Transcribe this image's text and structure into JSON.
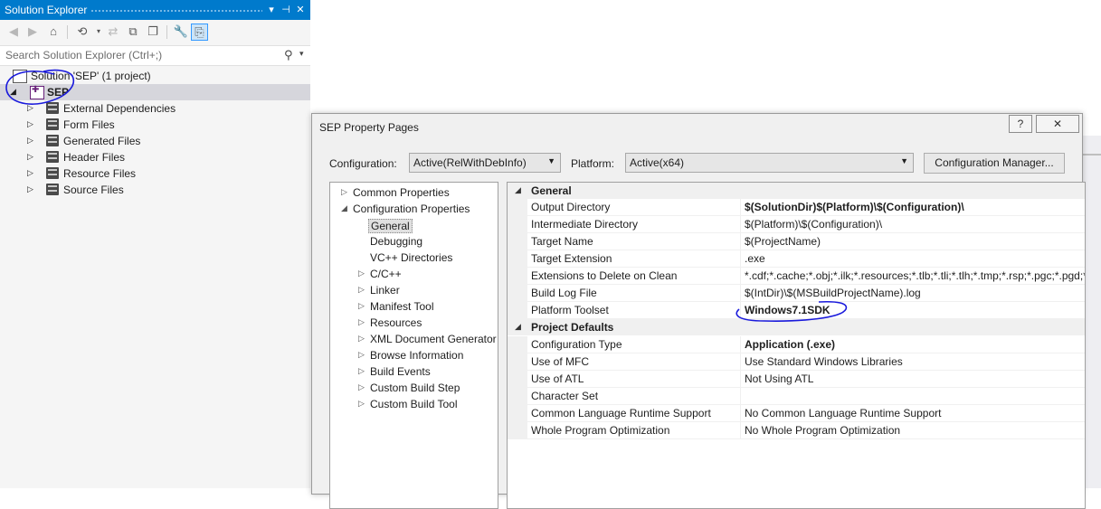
{
  "solution_explorer": {
    "title": "Solution Explorer",
    "title_buttons": [
      "▾",
      "⊣",
      "✕"
    ],
    "search_placeholder": "Search Solution Explorer (Ctrl+;)",
    "tree": [
      {
        "label": "Solution 'SEP' (1 project)",
        "icon": "solution-icon"
      },
      {
        "label": "SEP",
        "icon": "project-icon",
        "selected": true
      },
      {
        "label": "External Dependencies",
        "icon": "folder-icon"
      },
      {
        "label": "Form Files",
        "icon": "folder-icon"
      },
      {
        "label": "Generated Files",
        "icon": "folder-icon"
      },
      {
        "label": "Header Files",
        "icon": "folder-icon"
      },
      {
        "label": "Resource Files",
        "icon": "folder-icon"
      },
      {
        "label": "Source Files",
        "icon": "folder-icon"
      }
    ]
  },
  "dialog": {
    "title": "SEP Property Pages",
    "help_label": "?",
    "close_label": "✕",
    "configuration_label": "Configuration:",
    "configuration_value": "Active(RelWithDebInfo)",
    "platform_label": "Platform:",
    "platform_value": "Active(x64)",
    "config_manager_label": "Configuration Manager...",
    "left_tree": [
      {
        "label": "Common Properties",
        "level": 0,
        "expander": "▷"
      },
      {
        "label": "Configuration Properties",
        "level": 0,
        "expander": "◢"
      },
      {
        "label": "General",
        "level": 1,
        "expander": "",
        "selected": true
      },
      {
        "label": "Debugging",
        "level": 1,
        "expander": ""
      },
      {
        "label": "VC++ Directories",
        "level": 1,
        "expander": ""
      },
      {
        "label": "C/C++",
        "level": 1,
        "expander": "▷"
      },
      {
        "label": "Linker",
        "level": 1,
        "expander": "▷"
      },
      {
        "label": "Manifest Tool",
        "level": 1,
        "expander": "▷"
      },
      {
        "label": "Resources",
        "level": 1,
        "expander": "▷"
      },
      {
        "label": "XML Document Generator",
        "level": 1,
        "expander": "▷"
      },
      {
        "label": "Browse Information",
        "level": 1,
        "expander": "▷"
      },
      {
        "label": "Build Events",
        "level": 1,
        "expander": "▷"
      },
      {
        "label": "Custom Build Step",
        "level": 1,
        "expander": "▷"
      },
      {
        "label": "Custom Build Tool",
        "level": 1,
        "expander": "▷"
      }
    ],
    "grid": [
      {
        "category": "General"
      },
      {
        "name": "Output Directory",
        "value": "$(SolutionDir)$(Platform)\\$(Configuration)\\",
        "bold": true
      },
      {
        "name": "Intermediate Directory",
        "value": "$(Platform)\\$(Configuration)\\"
      },
      {
        "name": "Target Name",
        "value": "$(ProjectName)"
      },
      {
        "name": "Target Extension",
        "value": ".exe"
      },
      {
        "name": "Extensions to Delete on Clean",
        "value": "*.cdf;*.cache;*.obj;*.ilk;*.resources;*.tlb;*.tli;*.tlh;*.tmp;*.rsp;*.pgc;*.pgd;*.meta;"
      },
      {
        "name": "Build Log File",
        "value": "$(IntDir)\\$(MSBuildProjectName).log"
      },
      {
        "name": "Platform Toolset",
        "value": "Windows7.1SDK",
        "bold": true
      },
      {
        "category": "Project Defaults"
      },
      {
        "name": "Configuration Type",
        "value": "Application (.exe)",
        "bold": true
      },
      {
        "name": "Use of MFC",
        "value": "Use Standard Windows Libraries"
      },
      {
        "name": "Use of ATL",
        "value": "Not Using ATL"
      },
      {
        "name": "Character Set",
        "value": ""
      },
      {
        "name": "Common Language Runtime Support",
        "value": "No Common Language Runtime Support"
      },
      {
        "name": "Whole Program Optimization",
        "value": "No Whole Program Optimization"
      }
    ]
  },
  "colors": {
    "title_bar": "#007acc",
    "ink_annotation": "#1a1adc"
  }
}
